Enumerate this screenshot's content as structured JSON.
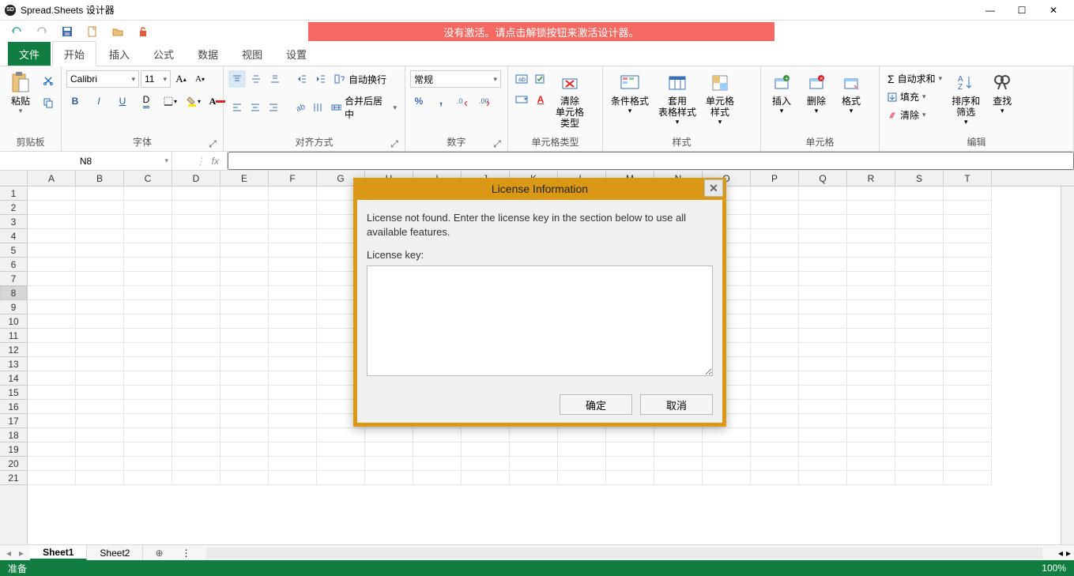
{
  "window": {
    "title": "Spread.Sheets 设计器",
    "min": "—",
    "max": "☐",
    "close": "✕"
  },
  "activation_banner": "没有激活。请点击解锁按钮来激活设计器。",
  "menu_tabs": {
    "file": "文件",
    "start": "开始",
    "insert": "插入",
    "formula": "公式",
    "data": "数据",
    "view": "视图",
    "settings": "设置"
  },
  "ribbon": {
    "clipboard": {
      "paste": "粘贴",
      "label": "剪贴板"
    },
    "font": {
      "name": "Calibri",
      "size": "11",
      "label": "字体",
      "bold": "B",
      "italic": "I",
      "underline": "U"
    },
    "align": {
      "wrap": "自动换行",
      "merge": "合并后居中",
      "label": "对齐方式"
    },
    "number": {
      "format": "常规",
      "label": "数字",
      "pct": "%",
      "comma": ","
    },
    "celltype": {
      "clear": "清除\n单元格\n类型",
      "label": "单元格类型"
    },
    "styles": {
      "cond": "条件格式",
      "table": "套用\n表格样式",
      "cell": "单元格\n样式",
      "label": "样式"
    },
    "cells": {
      "insert": "插入",
      "delete": "删除",
      "format": "格式",
      "label": "单元格"
    },
    "editing": {
      "sum": "自动求和",
      "fill": "填充",
      "clear": "清除",
      "sort": "排序和\n筛选",
      "find": "查找",
      "label": "编辑"
    }
  },
  "formulabar": {
    "name": "N8",
    "fx": "fx"
  },
  "columns": [
    "A",
    "B",
    "C",
    "D",
    "E",
    "F",
    "G",
    "H",
    "I",
    "J",
    "K",
    "L",
    "M",
    "N",
    "O",
    "P",
    "Q",
    "R",
    "S",
    "T"
  ],
  "rows": [
    "1",
    "2",
    "3",
    "4",
    "5",
    "6",
    "7",
    "8",
    "9",
    "10",
    "11",
    "12",
    "13",
    "14",
    "15",
    "16",
    "17",
    "18",
    "19",
    "20",
    "21"
  ],
  "selected_row": "8",
  "sheets": {
    "active": "Sheet1",
    "other": "Sheet2",
    "add": "⊕"
  },
  "statusbar": {
    "ready": "准备",
    "zoom": "100%"
  },
  "dialog": {
    "title": "License Information",
    "msg": "License not found. Enter the license key in the section below to use all available features.",
    "keylabel": "License key:",
    "ok": "确定",
    "cancel": "取消",
    "close": "✕"
  }
}
